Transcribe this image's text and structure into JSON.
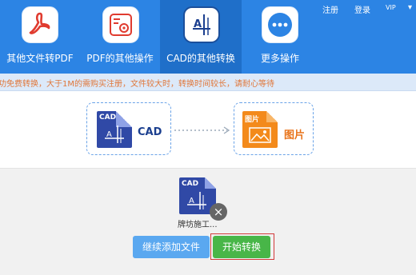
{
  "toolbar": {
    "tools": [
      {
        "label": "其他文件转PDF",
        "icon": "pdf-icon"
      },
      {
        "label": "PDF的其他操作",
        "icon": "settings-icon"
      },
      {
        "label": "CAD的其他转换",
        "icon": "cad-icon",
        "active": true
      },
      {
        "label": "更多操作",
        "icon": "more-icon"
      }
    ],
    "links": {
      "register": "注册",
      "login": "登录",
      "vip": "VIP"
    }
  },
  "notice": "功免费转换，大于1M的需购买注册，文件较大时，转换时间较长，请耐心等待",
  "conversion": {
    "from_tag": "CAD",
    "from_label": "CAD",
    "to_tag": "图片",
    "to_label": "图片"
  },
  "file": {
    "tag": "CAD",
    "name": "牌坊施工..."
  },
  "buttons": {
    "add": "继续添加文件",
    "start": "开始转换"
  },
  "colors": {
    "toolbar": "#2c84e4",
    "cad_doc": "#3049a6",
    "image_doc": "#f38a1b",
    "notice_text": "#e0773a",
    "add_button": "#5aa8f0",
    "start_button": "#48b648"
  }
}
